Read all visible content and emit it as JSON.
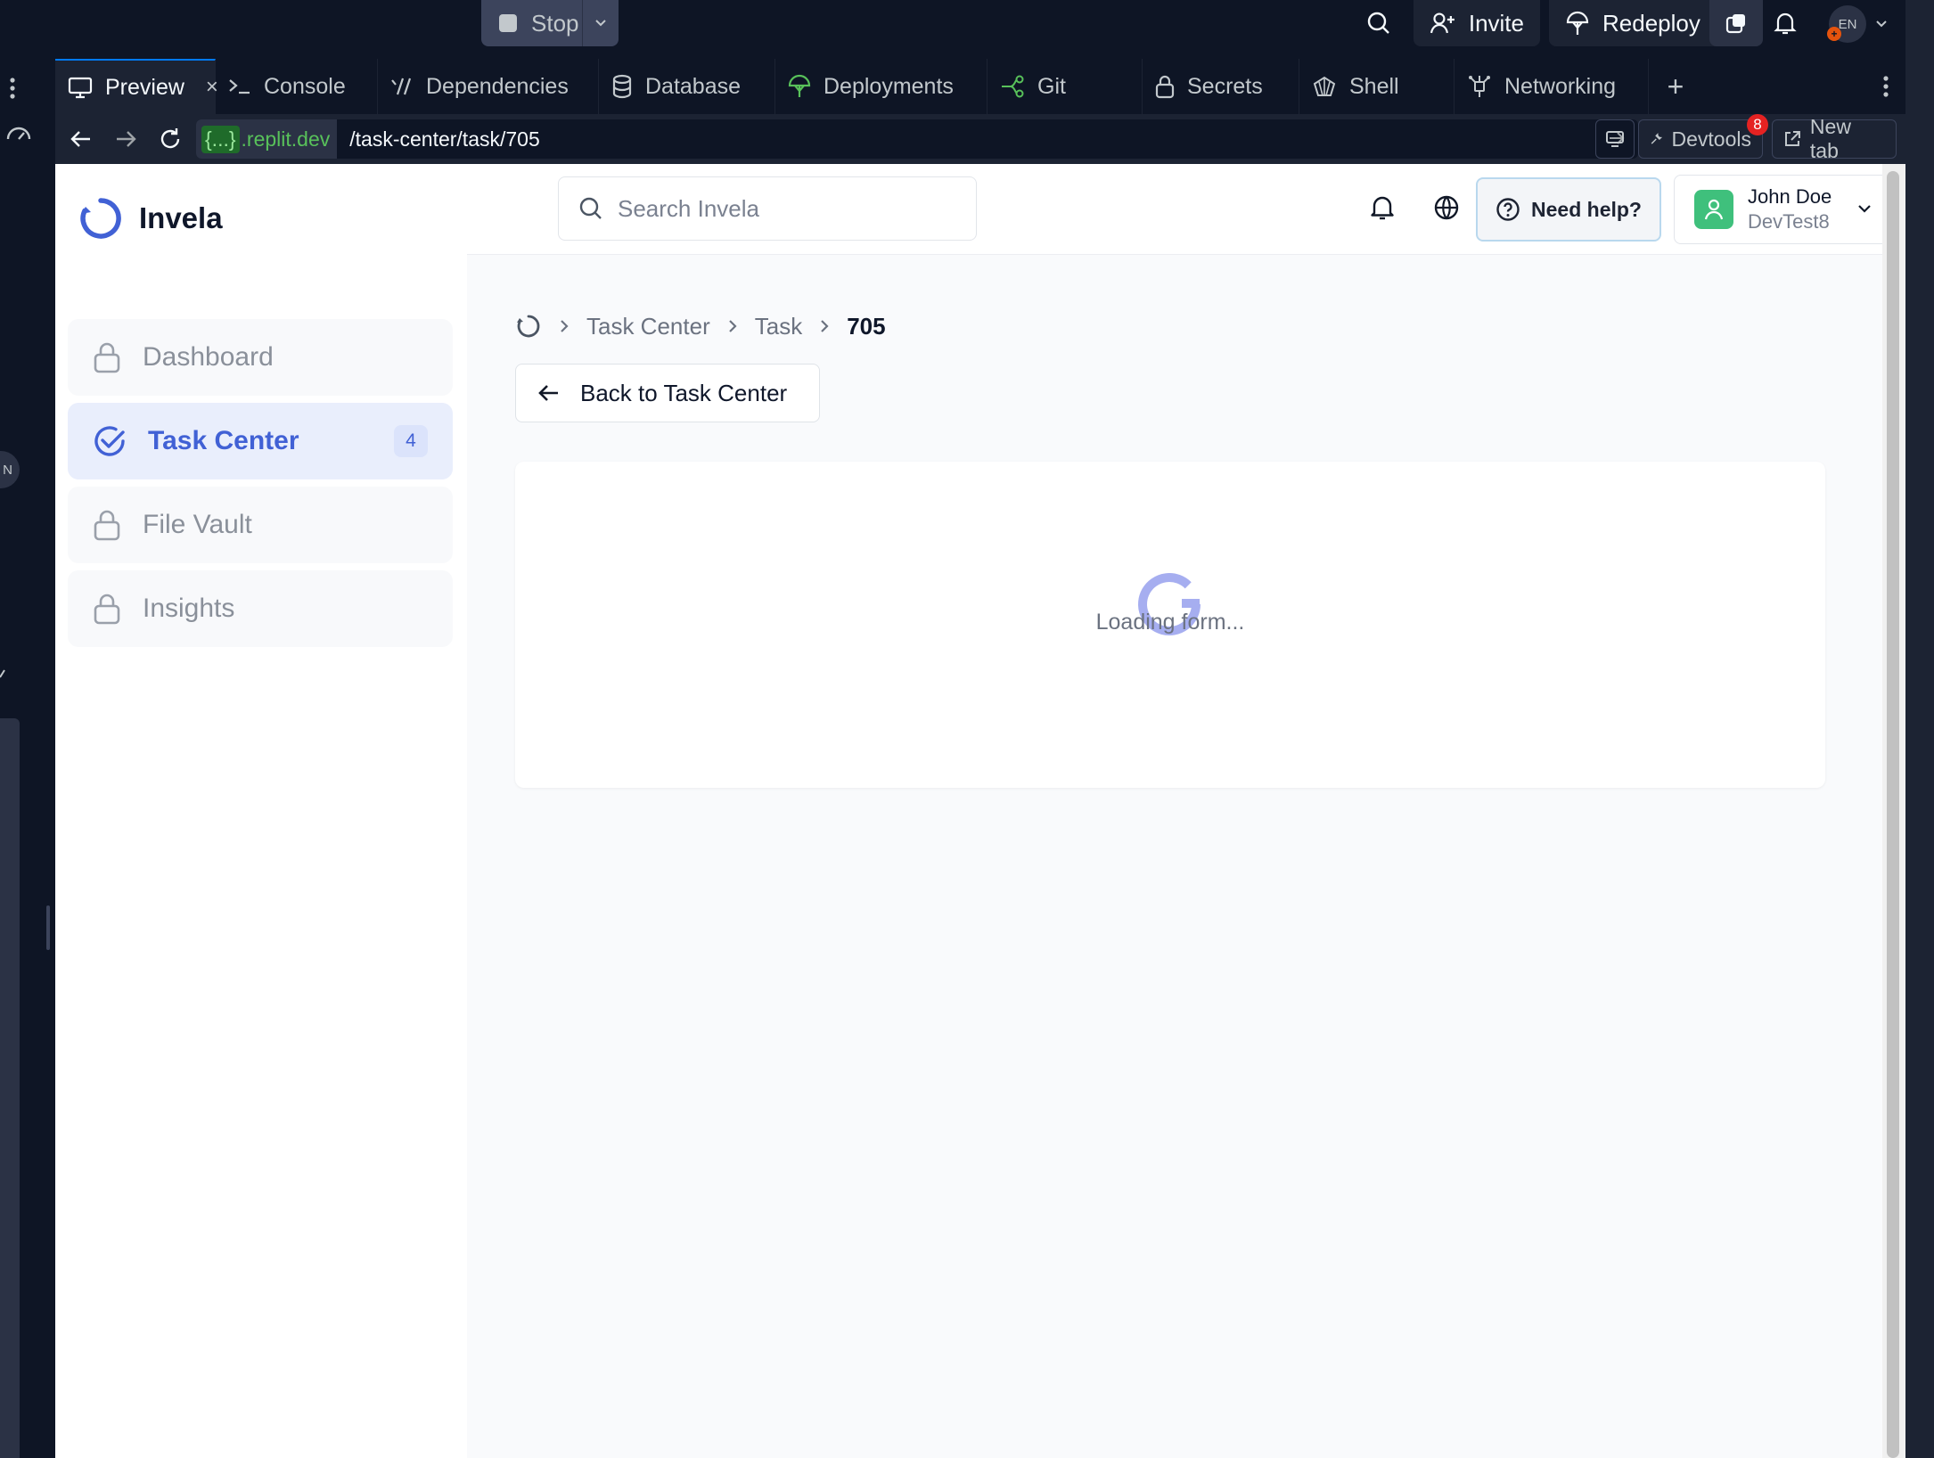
{
  "replit": {
    "stop_label": "Stop",
    "invite_label": "Invite",
    "redeploy_label": "Redeploy",
    "language_badge": "EN",
    "tabs": [
      {
        "label": "Preview",
        "icon": "monitor-icon"
      },
      {
        "label": "Console",
        "icon": "terminal-icon"
      },
      {
        "label": "Dependencies",
        "icon": "dependencies-icon"
      },
      {
        "label": "Database",
        "icon": "database-icon"
      },
      {
        "label": "Deployments",
        "icon": "deployments-icon"
      },
      {
        "label": "Git",
        "icon": "git-icon"
      },
      {
        "label": "Secrets",
        "icon": "lock-icon"
      },
      {
        "label": "Shell",
        "icon": "shell-icon"
      },
      {
        "label": "Networking",
        "icon": "networking-icon"
      }
    ],
    "url_host": ".replit.dev",
    "url_host_brace": "{...}",
    "url_path": "/task-center/task/705",
    "devtools_label": "Devtools",
    "devtools_count": "8",
    "new_tab_label": "New tab",
    "strip_label": "N"
  },
  "app": {
    "brand": "Invela",
    "accent": "#4161d5",
    "search_placeholder": "Search Invela",
    "help_label": "Need help?",
    "user": {
      "name": "John Doe",
      "org": "DevTest8"
    },
    "nav": [
      {
        "label": "Dashboard",
        "locked": true
      },
      {
        "label": "Task Center",
        "locked": false,
        "active": true,
        "count": "4"
      },
      {
        "label": "File Vault",
        "locked": true
      },
      {
        "label": "Insights",
        "locked": true
      }
    ],
    "breadcrumb": [
      "Task Center",
      "Task",
      "705"
    ],
    "back_label": "Back to Task Center",
    "loading_text": "Loading form..."
  }
}
